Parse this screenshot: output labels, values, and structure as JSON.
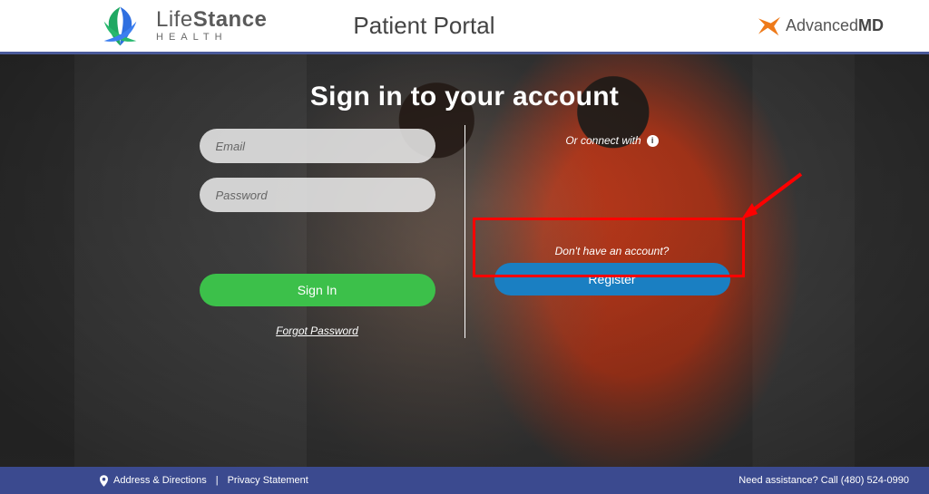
{
  "header": {
    "lifestance_top_light": "Life",
    "lifestance_top_bold": "Stance",
    "lifestance_bottom": "HEALTH",
    "portal_title": "Patient Portal",
    "advancedmd_prefix": "Advanced",
    "advancedmd_suffix": "MD"
  },
  "signin": {
    "title": "Sign in to your account",
    "email_placeholder": "Email",
    "password_placeholder": "Password",
    "signin_label": "Sign In",
    "forgot_label": "Forgot Password"
  },
  "connect": {
    "or_connect_with": "Or connect with",
    "no_account": "Don't have an account?",
    "register_label": "Register"
  },
  "footer": {
    "address_directions": "Address & Directions",
    "privacy": "Privacy Statement",
    "assistance": "Need assistance? Call (480) 524-0990"
  },
  "colors": {
    "accent_green": "#3cc04a",
    "accent_blue": "#1a7fc2",
    "footer_bg": "#3b4a8f",
    "highlight": "#ff0000"
  }
}
